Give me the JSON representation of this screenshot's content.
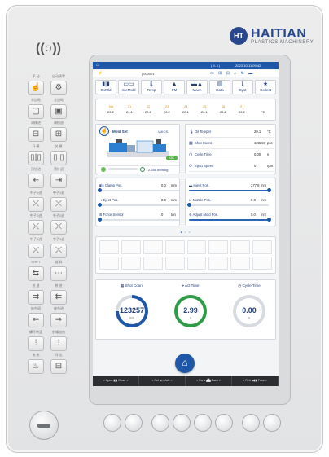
{
  "brand": {
    "badge": "HT",
    "name": "HAITIAN",
    "subtitle": "PLASTICS MACHINERY"
  },
  "speaker_icon": "((○))",
  "left_keys": [
    {
      "labels": [
        "手 动",
        "自动清零"
      ],
      "icons": [
        "hand-icon",
        "gear-icon"
      ]
    },
    {
      "labels": [
        "半自动",
        "全自动"
      ],
      "icons": [
        "half-auto-icon",
        "full-auto-icon"
      ]
    },
    {
      "labels": [
        "调模进",
        "调模退"
      ],
      "icons": [
        "mold-adjust-in-icon",
        "mold-adjust-out-icon"
      ]
    },
    {
      "labels": [
        "开 模",
        "关 模"
      ],
      "icons": [
        "mold-open-icon",
        "mold-close-icon"
      ]
    },
    {
      "labels": [
        "顶针进",
        "顶针退"
      ],
      "icons": [
        "ejector-forward-icon",
        "ejector-back-icon"
      ]
    },
    {
      "labels": [
        "中子1进",
        "中子1退"
      ],
      "icons": [
        "core1-in-icon",
        "core1-out-icon"
      ]
    },
    {
      "labels": [
        "中子2进",
        "中子2退"
      ],
      "icons": [
        "core2-in-icon",
        "core2-out-icon"
      ]
    },
    {
      "labels": [
        "中子3进",
        "中子3退"
      ],
      "icons": [
        "core3-in-icon",
        "core3-out-icon"
      ]
    },
    {
      "labels": [
        "SHIFT",
        "储 料"
      ],
      "icons": [
        "shift-icon",
        "charge-icon"
      ]
    },
    {
      "labels": [
        "射 退",
        "射 进"
      ],
      "icons": [
        "injection-back-icon",
        "injection-forward-icon"
      ]
    },
    {
      "labels": [
        "座台退",
        "座台进"
      ],
      "icons": [
        "carriage-back-icon",
        "carriage-forward-icon"
      ]
    },
    {
      "labels": [
        "螺杆转速",
        "射嘴加热"
      ],
      "icons": [
        "screw-speed-icon",
        "nozzle-heat-icon"
      ]
    },
    {
      "labels": [
        "电 热",
        "马 达"
      ],
      "icons": [
        "heater-icon",
        "motor-icon"
      ]
    }
  ],
  "statusbar": {
    "home_glyph": "⌂",
    "info": "| ⚠ 1 |",
    "datetime": "2023-10-11  09:42"
  },
  "subbar": {
    "alarm_glyph": "⚡",
    "mold_code": "[ 000001",
    "icons_text": "▭ ⊞ ⊟ ⌂ ⇅ ▬"
  },
  "nav_tabs": [
    {
      "label": "OvMld",
      "icon": "▮|▮"
    },
    {
      "label": "InjeMold",
      "icon": "▭▭"
    },
    {
      "label": "Temp",
      "icon": "🌡"
    },
    {
      "label": "PM",
      "icon": "▲"
    },
    {
      "label": "Mach",
      "icon": "▬▲"
    },
    {
      "label": "Data",
      "icon": "▤"
    },
    {
      "label": "Syst",
      "icon": "ℹ"
    },
    {
      "label": "Collect",
      "icon": "★"
    }
  ],
  "temperature": {
    "labels": [
      "Nzl",
      "Z1",
      "Z2",
      "Z3",
      "Z4",
      "Z5",
      "Z6",
      "Z7"
    ],
    "values": [
      "20.2",
      "20.1",
      "20.2",
      "20.2",
      "20.1",
      "20.1",
      "20.2",
      "20.2"
    ],
    "unit": "°C"
  },
  "mold": {
    "title": "Mold Set",
    "mode": "/AKCS",
    "ok_badge": "OK",
    "energy": "2.256 kWh/kg"
  },
  "info": [
    {
      "icon": "🌡",
      "label": "Oil Temper",
      "value": "20.1",
      "unit": "°C"
    },
    {
      "icon": "▦",
      "label": "Shot Count",
      "value": "123257",
      "unit": "pcs"
    },
    {
      "icon": "◷",
      "label": "Cycle Time",
      "value": "0.00",
      "unit": "s"
    },
    {
      "icon": "⟳",
      "label": "Inject Speed",
      "value": "0",
      "unit": "rpm"
    }
  ],
  "positions_left": [
    {
      "icon": "▮|▮",
      "label": "Clamp Pos.",
      "value": "0.0",
      "unit": "mm",
      "fill": 0.0
    },
    {
      "icon": "⇥",
      "label": "Eject Pos.",
      "value": "0.0",
      "unit": "mm",
      "fill": 0.0
    },
    {
      "icon": "⊞",
      "label": "Force Sensor",
      "value": "0",
      "unit": "ton",
      "fill": 0.0
    }
  ],
  "positions_right": [
    {
      "icon": "▬",
      "label": "Inject Pos.",
      "value": "277.8",
      "unit": "mm",
      "fill": 1.0
    },
    {
      "icon": "⊳",
      "label": "Nozzle Pos.",
      "value": "0.0",
      "unit": "mm",
      "fill": 0.0
    },
    {
      "icon": "⚙",
      "label": "Adjust Mold Pos.",
      "value": "0.0",
      "unit": "mm",
      "fill": 1.0
    }
  ],
  "page_dots": "● ○ ○",
  "gauges": [
    {
      "icon": "▦",
      "label": "Shot Count",
      "value": "123257",
      "unit": "pcs",
      "color": "#1f57a8",
      "fill": 0.75
    },
    {
      "icon": "⌖",
      "label": "Act Time",
      "value": "2.99",
      "unit": "s",
      "color": "#2e9c46",
      "fill": 1.0
    },
    {
      "icon": "◷",
      "label": "Cycle Time",
      "value": "0.00",
      "unit": "s",
      "color": "#b7bcc4",
      "fill": 0.0
    }
  ],
  "home_glyph": "⌂",
  "softkeys": [
    "< Open ▮|▮ Close >",
    "< Ret ▶▷ Adv >",
    "< Forw ▟▙ Back >",
    "< Retr ◀▮▮ Forw >"
  ],
  "colors": {
    "brand_blue": "#28478f",
    "accent_blue": "#1f57a8",
    "ok_green": "#57b04a",
    "temp_label": "#d08a17"
  }
}
